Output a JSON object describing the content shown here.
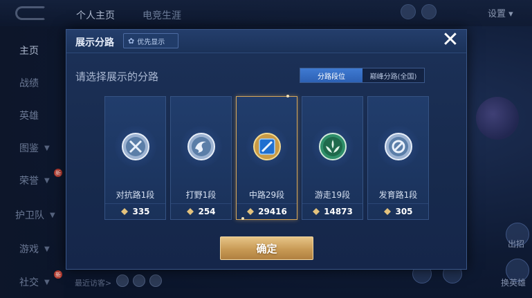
{
  "background": {
    "tabs": [
      "个人主页",
      "电竞生涯"
    ],
    "settings_label": "设置",
    "sidebar": [
      {
        "label": "主页",
        "chevron": false,
        "badge": ""
      },
      {
        "label": "战绩",
        "chevron": false,
        "badge": ""
      },
      {
        "label": "英雄",
        "chevron": false,
        "badge": ""
      },
      {
        "label": "图鉴",
        "chevron": true,
        "badge": ""
      },
      {
        "label": "荣誉",
        "chevron": true,
        "badge": "新"
      },
      {
        "label": "护卫队",
        "chevron": true,
        "badge": ""
      },
      {
        "label": "游戏",
        "chevron": true,
        "badge": ""
      },
      {
        "label": "社交",
        "chevron": true,
        "badge": "新"
      }
    ],
    "recent_visitors": "最近访客>",
    "right_buttons": [
      "出招",
      "换英雄"
    ]
  },
  "modal": {
    "title": "展示分路",
    "priority_button": "优先显示",
    "close_glyph": "✕",
    "prompt": "请选择展示的分路",
    "toggle": {
      "active": "分路段位",
      "inactive": "巅峰分路(全国)"
    },
    "cards": [
      {
        "name": "对抗路1段",
        "score": "335",
        "emblem": "clash-lane-icon",
        "selected": false
      },
      {
        "name": "打野1段",
        "score": "254",
        "emblem": "jungle-icon",
        "selected": false
      },
      {
        "name": "中路29段",
        "score": "29416",
        "emblem": "mid-lane-icon",
        "selected": true
      },
      {
        "name": "游走19段",
        "score": "14873",
        "emblem": "roam-icon",
        "selected": false
      },
      {
        "name": "发育路1段",
        "score": "305",
        "emblem": "farm-lane-icon",
        "selected": false
      }
    ],
    "confirm_label": "确定"
  },
  "colors": {
    "accent_blue": "#2d61b4",
    "gold": "#d7a85a",
    "panel": "#1c3158"
  }
}
